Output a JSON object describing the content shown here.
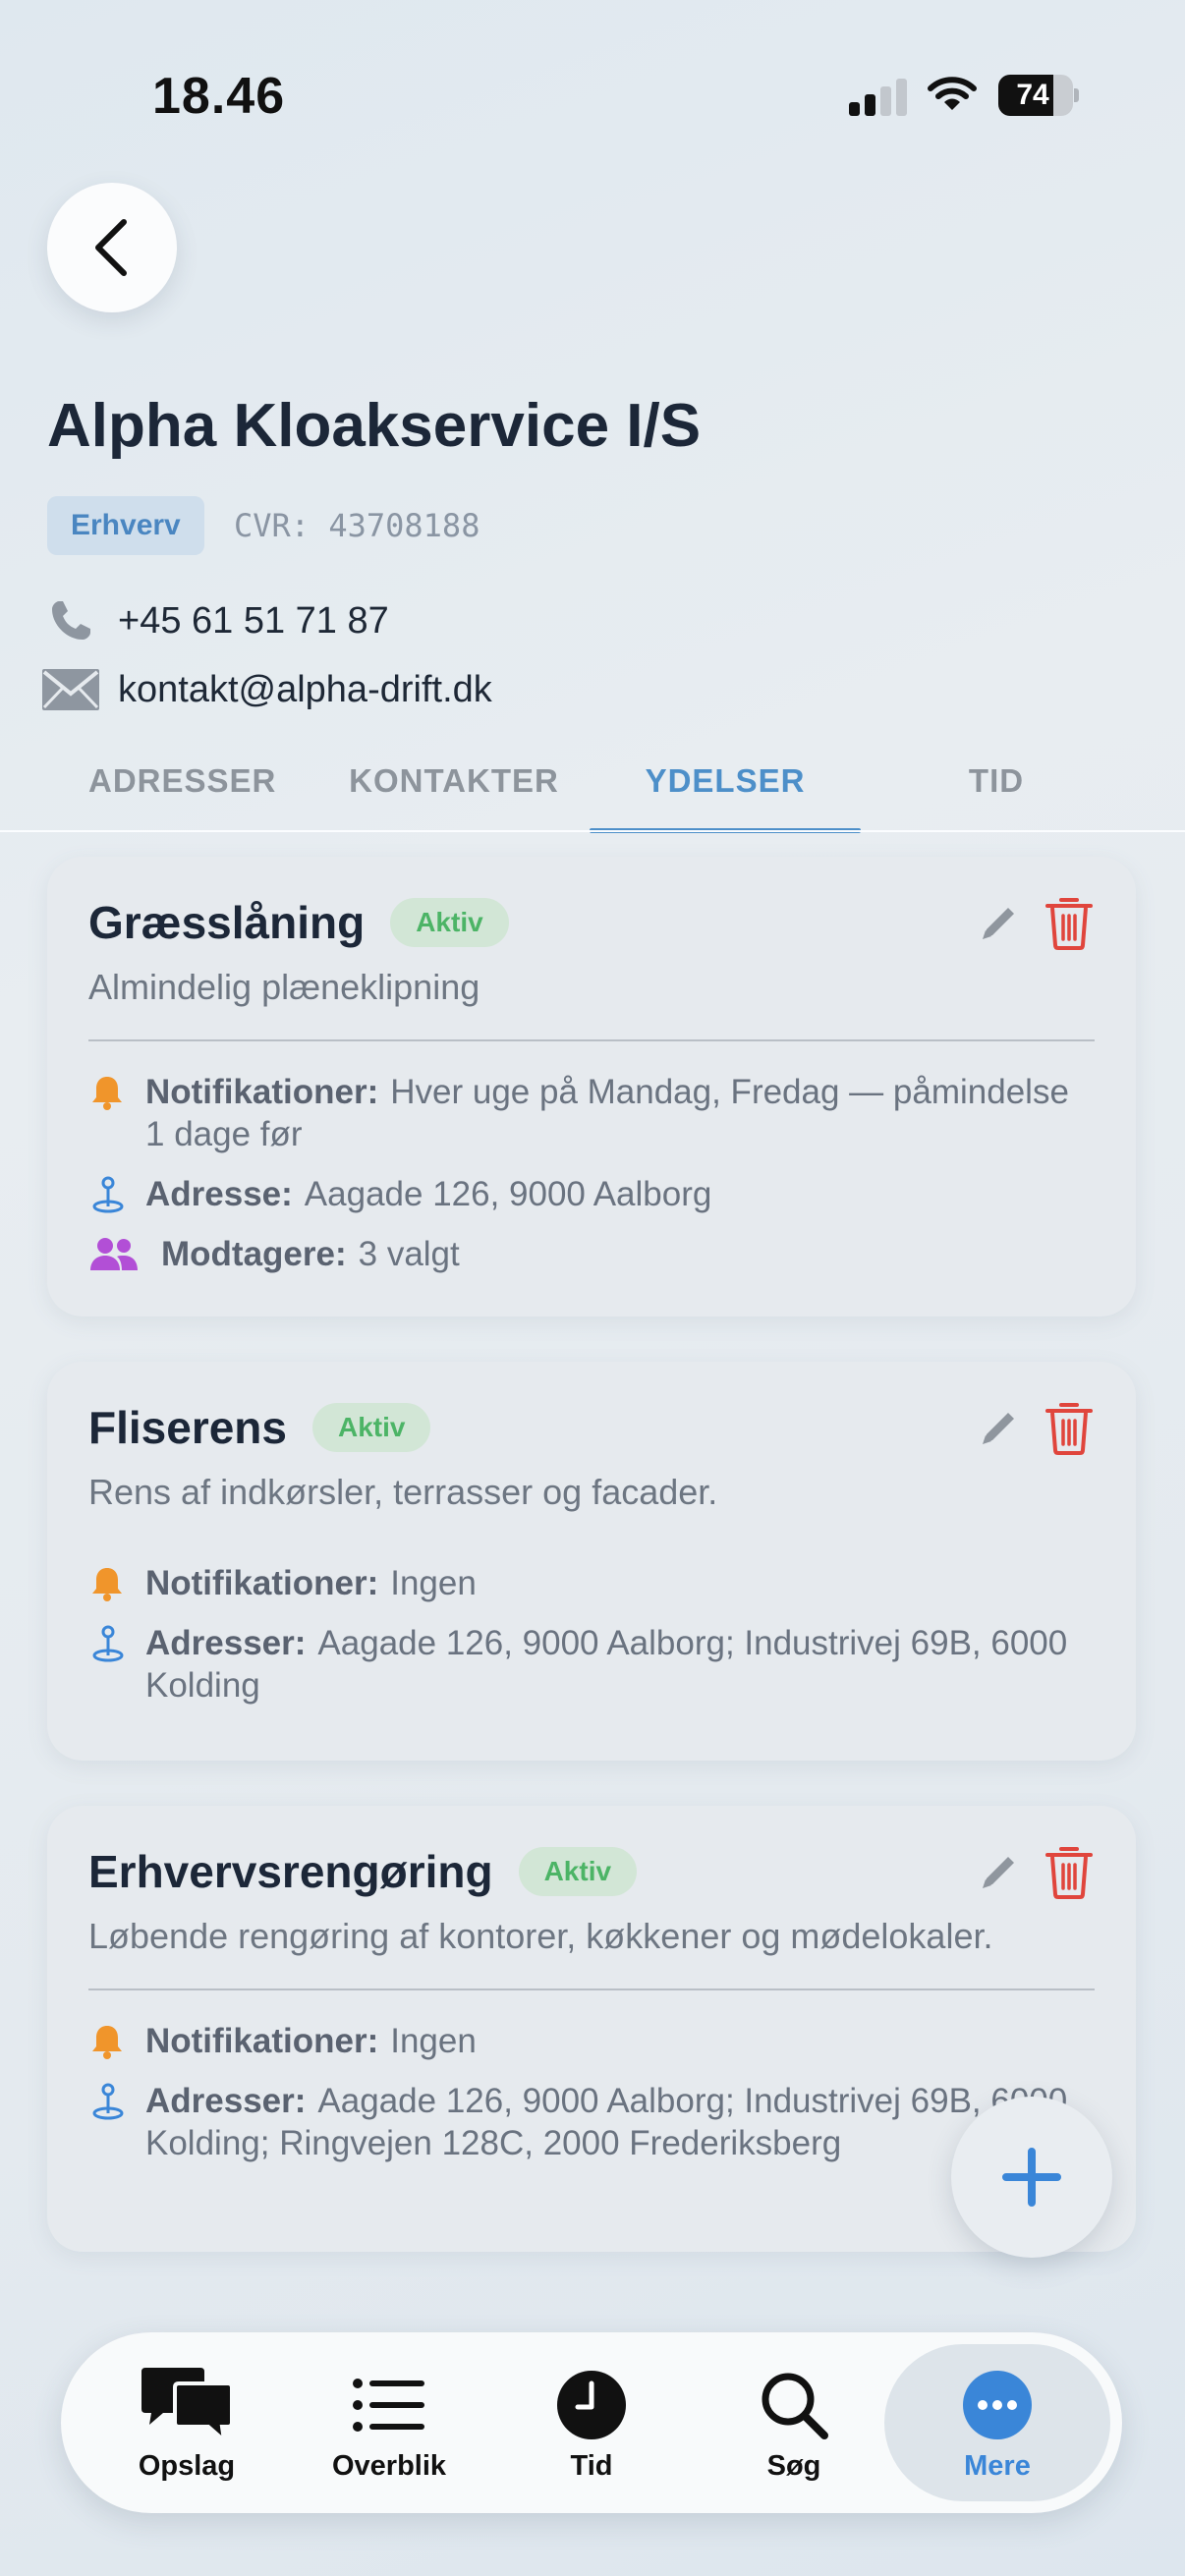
{
  "status_bar": {
    "time": "18.46",
    "battery": "74",
    "battery_level": 0.74
  },
  "header": {
    "title": "Alpha Kloakservice I/S",
    "type_badge": "Erhverv",
    "cvr": "CVR: 43708188",
    "phone": "+45 61 51 71 87",
    "email": "kontakt@alpha-drift.dk"
  },
  "tabs": [
    "ADRESSER",
    "KONTAKTER",
    "YDELSER",
    "TID"
  ],
  "active_tab": "YDELSER",
  "services": [
    {
      "title": "Græsslåning",
      "status": "Aktiv",
      "description": "Almindelig plæneklipning",
      "notifications_label": "Notifikationer:",
      "notifications_value": "Hver uge på Mandag, Fredag — påmindelse 1 dage før",
      "address_label": "Adresse:",
      "address_value": "Aagade 126, 9000 Aalborg",
      "recipients_label": "Modtagere:",
      "recipients_value": "3 valgt"
    },
    {
      "title": "Fliserens",
      "status": "Aktiv",
      "description": "Rens af indkørsler, terrasser og facader.",
      "notifications_label": "Notifikationer:",
      "notifications_value": "Ingen",
      "address_label": "Adresser:",
      "address_value": "Aagade 126, 9000 Aalborg; Industrivej 69B, 6000 Kolding"
    },
    {
      "title": "Erhvervsrengøring",
      "status": "Aktiv",
      "description": "Løbende rengøring af kontorer, køkkener og mødelokaler.",
      "notifications_label": "Notifikationer:",
      "notifications_value": "Ingen",
      "address_label": "Adresser:",
      "address_value": "Aagade 126, 9000 Aalborg; Industrivej 69B, 6000 Kolding; Ringvejen 128C, 2000 Frederiksberg"
    }
  ],
  "bottom_nav": [
    {
      "label": "Opslag",
      "icon": "chat-bubbles-icon"
    },
    {
      "label": "Overblik",
      "icon": "list-icon"
    },
    {
      "label": "Tid",
      "icon": "clock-icon"
    },
    {
      "label": "Søg",
      "icon": "search-icon"
    },
    {
      "label": "Mere",
      "icon": "more-icon"
    }
  ],
  "active_nav": "Mere",
  "colors": {
    "accent": "#4d8fc9",
    "status_active": "#4cb466",
    "delete": "#e0453c",
    "bell": "#f0952b",
    "recipients": "#b24fd6",
    "fab_plus": "#3a86d8"
  }
}
